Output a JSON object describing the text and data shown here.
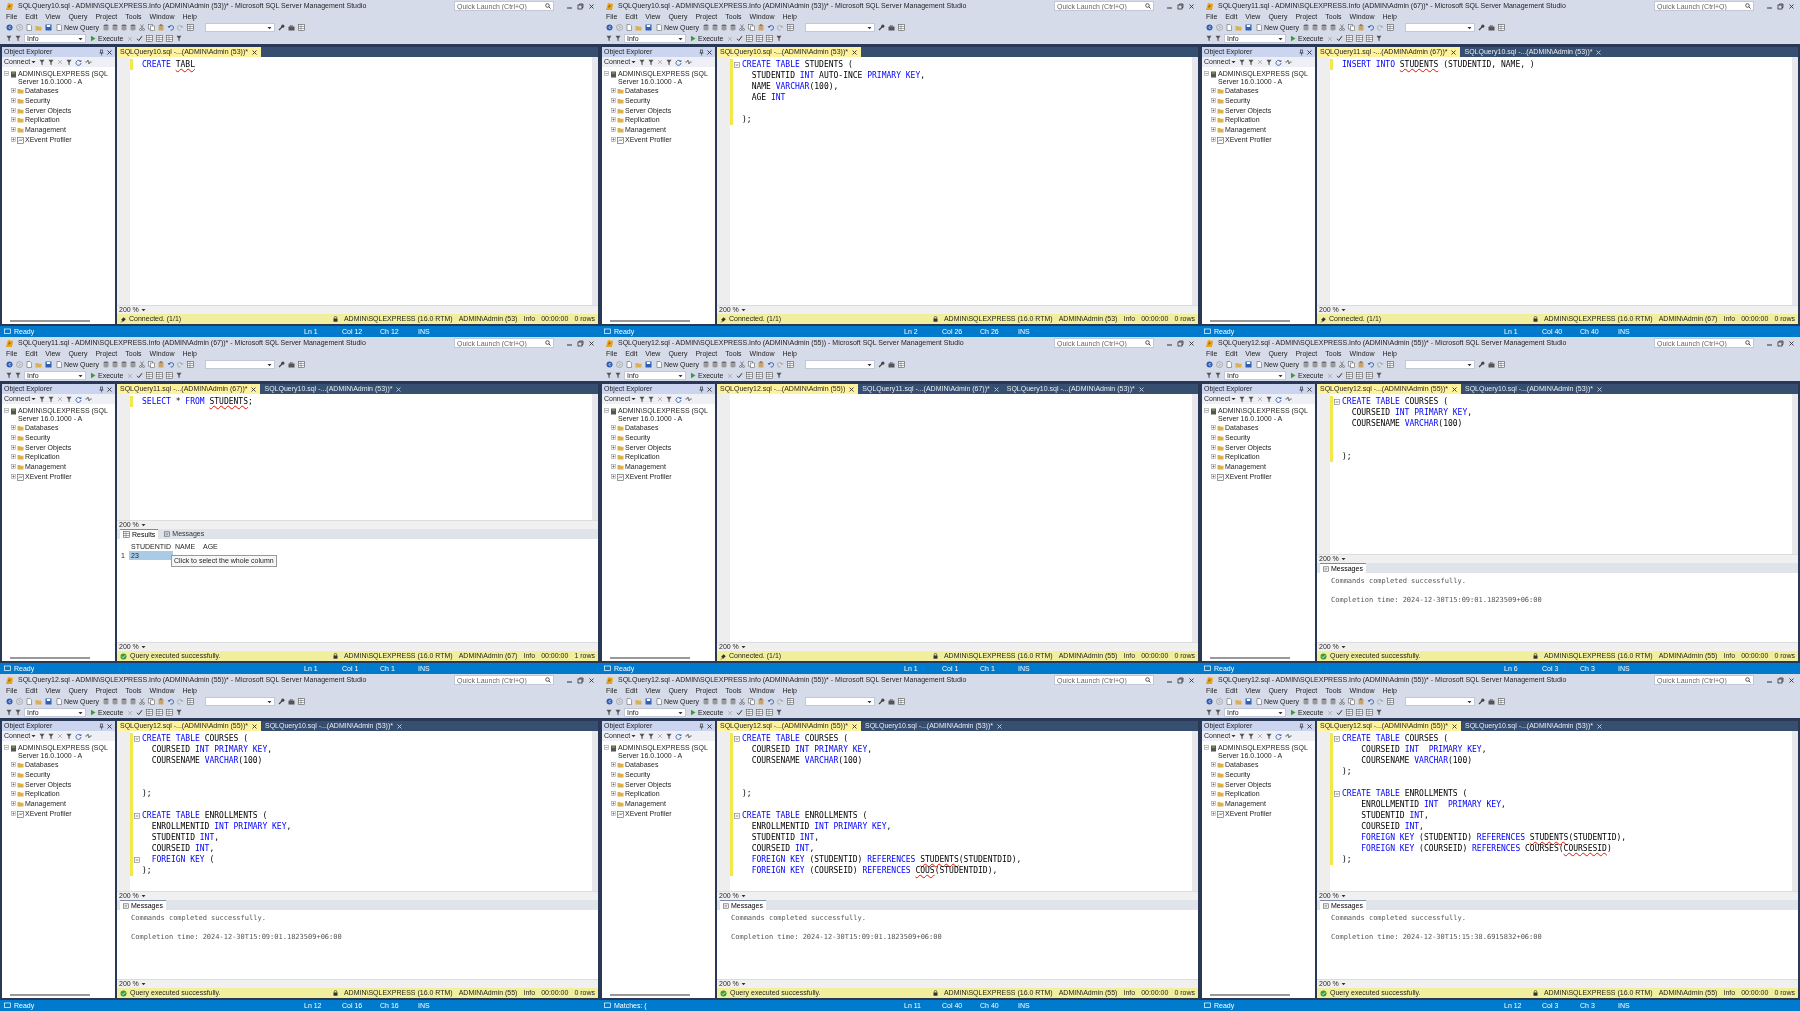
{
  "panels": [
    {
      "title": "SQLQuery10.sql - ADMIN\\SQLEXPRESS.Info (ADMIN\\Admin (53))* - Microsoft SQL Server Management Studio",
      "quick_launch": {
        "placeholder": "Quick Launch (Ctrl+Q)"
      },
      "menu": [
        "File",
        "Edit",
        "View",
        "Query",
        "Project",
        "Tools",
        "Window",
        "Help"
      ],
      "toolbar": {
        "new_query": "New Query",
        "database": "Info",
        "execute": "Execute"
      },
      "object_explorer": {
        "title": "Object Explorer",
        "connect": "Connect",
        "nodes": [
          {
            "label": "ADMIN\\SQLEXPRESS (SQL Server 16.0.1000 - A",
            "kind": "server",
            "expanded": true,
            "children": [
              {
                "label": "Databases",
                "kind": "folder",
                "expanded": false
              },
              {
                "label": "Security",
                "kind": "folder",
                "expanded": false
              },
              {
                "label": "Server Objects",
                "kind": "folder",
                "expanded": false
              },
              {
                "label": "Replication",
                "kind": "folder",
                "expanded": false
              },
              {
                "label": "Management",
                "kind": "folder",
                "expanded": false
              },
              {
                "label": "XEvent Profiler",
                "kind": "profiler",
                "expanded": false
              }
            ]
          }
        ]
      },
      "tabs": [
        {
          "label": "SQLQuery10.sql -...(ADMIN\\Admin (53))*",
          "selected": true
        }
      ],
      "code": [
        {
          "fold": false,
          "parts": [
            {
              "text": "CREATE ",
              "kind": "keyword"
            },
            {
              "text": "TABL",
              "kind": "error"
            }
          ]
        }
      ],
      "editor_zoom": "200 %",
      "query_status": {
        "kind": "connected",
        "text": "Connected. (1/1)"
      },
      "server": "ADMIN\\SQLEXPRESS (16.0 RTM)",
      "session": "ADMIN\\Admin (53)",
      "database": "Info",
      "elapsed": "00:00:00",
      "rows": "0 rows",
      "status_bar": {
        "message": "Ready",
        "line": "Ln 1",
        "column": "Col 12",
        "char": "Ch 12",
        "mode": "INS"
      }
    },
    {
      "title": "SQLQuery10.sql - ADMIN\\SQLEXPRESS.Info (ADMIN\\Admin (53))* - Microsoft SQL Server Management Studio",
      "quick_launch": {
        "placeholder": "Quick Launch (Ctrl+Q)"
      },
      "menu": [
        "File",
        "Edit",
        "View",
        "Query",
        "Project",
        "Tools",
        "Window",
        "Help"
      ],
      "toolbar": {
        "new_query": "New Query",
        "database": "Info",
        "execute": "Execute"
      },
      "object_explorer": {
        "title": "Object Explorer",
        "connect": "Connect",
        "nodes": [
          {
            "label": "ADMIN\\SQLEXPRESS (SQL Server 16.0.1000 - A",
            "kind": "server",
            "expanded": true,
            "children": [
              {
                "label": "Databases",
                "kind": "folder",
                "expanded": false
              },
              {
                "label": "Security",
                "kind": "folder",
                "expanded": false
              },
              {
                "label": "Server Objects",
                "kind": "folder",
                "expanded": false
              },
              {
                "label": "Replication",
                "kind": "folder",
                "expanded": false
              },
              {
                "label": "Management",
                "kind": "folder",
                "expanded": false
              },
              {
                "label": "XEvent Profiler",
                "kind": "profiler",
                "expanded": false
              }
            ]
          }
        ]
      },
      "tabs": [
        {
          "label": "SQLQuery10.sql -...(ADMIN\\Admin (53))*",
          "selected": true
        }
      ],
      "code": [
        {
          "fold": true,
          "parts": [
            {
              "text": "CREATE TABLE ",
              "kind": "keyword"
            },
            {
              "text": "STUDENTS (",
              "kind": "plain"
            }
          ]
        },
        {
          "fold": false,
          "parts": [
            {
              "text": "  STUDENTID ",
              "kind": "plain"
            },
            {
              "text": "INT ",
              "kind": "keyword"
            },
            {
              "text": "AUTO-INCE ",
              "kind": "plain"
            },
            {
              "text": "PRIMARY KEY",
              "kind": "keyword"
            },
            {
              "text": ",",
              "kind": "plain"
            }
          ]
        },
        {
          "fold": false,
          "parts": [
            {
              "text": "  NAME ",
              "kind": "plain"
            },
            {
              "text": "VARCHAR",
              "kind": "keyword"
            },
            {
              "text": "(100),",
              "kind": "plain"
            }
          ]
        },
        {
          "fold": false,
          "parts": [
            {
              "text": "  AGE ",
              "kind": "plain"
            },
            {
              "text": "INT",
              "kind": "keyword"
            }
          ]
        },
        {
          "fold": false
        },
        {
          "fold": false,
          "parts": [
            {
              "text": ");",
              "kind": "plain"
            }
          ]
        }
      ],
      "editor_zoom": "200 %",
      "query_status": {
        "kind": "connected",
        "text": "Connected. (1/1)"
      },
      "server": "ADMIN\\SQLEXPRESS (16.0 RTM)",
      "session": "ADMIN\\Admin (53)",
      "database": "Info",
      "elapsed": "00:00:00",
      "rows": "0 rows",
      "status_bar": {
        "message": "Ready",
        "line": "Ln 2",
        "column": "Col 26",
        "char": "Ch 26",
        "mode": "INS"
      }
    },
    {
      "title": "SQLQuery11.sql - ADMIN\\SQLEXPRESS.Info (ADMIN\\Admin (67))* - Microsoft SQL Server Management Studio",
      "quick_launch": {
        "placeholder": "Quick Launch (Ctrl+Q)"
      },
      "menu": [
        "File",
        "Edit",
        "View",
        "Query",
        "Project",
        "Tools",
        "Window",
        "Help"
      ],
      "toolbar": {
        "new_query": "New Query",
        "database": "Info",
        "execute": "Execute"
      },
      "object_explorer": {
        "title": "Object Explorer",
        "connect": "Connect",
        "nodes": [
          {
            "label": "ADMIN\\SQLEXPRESS (SQL Server 16.0.1000 - A",
            "kind": "server",
            "expanded": true,
            "children": [
              {
                "label": "Databases",
                "kind": "folder",
                "expanded": false
              },
              {
                "label": "Security",
                "kind": "folder",
                "expanded": false
              },
              {
                "label": "Server Objects",
                "kind": "folder",
                "expanded": false
              },
              {
                "label": "Replication",
                "kind": "folder",
                "expanded": false
              },
              {
                "label": "Management",
                "kind": "folder",
                "expanded": false
              },
              {
                "label": "XEvent Profiler",
                "kind": "profiler",
                "expanded": false
              }
            ]
          }
        ]
      },
      "tabs": [
        {
          "label": "SQLQuery11.sql -...(ADMIN\\Admin (67))*",
          "selected": true
        },
        {
          "label": "SQLQuery10.sql -...(ADMIN\\Admin (53))*",
          "selected": false
        }
      ],
      "code": [
        {
          "fold": false,
          "parts": [
            {
              "text": "INSERT INTO ",
              "kind": "keyword"
            },
            {
              "text": "STUDENTS",
              "kind": "error"
            },
            {
              "text": " (STUDENTID, NAME, )",
              "kind": "plain"
            }
          ]
        }
      ],
      "editor_zoom": "200 %",
      "query_status": {
        "kind": "connected",
        "text": "Connected. (1/1)"
      },
      "server": "ADMIN\\SQLEXPRESS (16.0 RTM)",
      "session": "ADMIN\\Admin (67)",
      "database": "Info",
      "elapsed": "00:00:00",
      "rows": "0 rows",
      "status_bar": {
        "message": "Ready",
        "line": "Ln 1",
        "column": "Col 40",
        "char": "Ch 40",
        "mode": "INS"
      }
    },
    {
      "title": "SQLQuery11.sql - ADMIN\\SQLEXPRESS.Info (ADMIN\\Admin (67))* - Microsoft SQL Server Management Studio",
      "quick_launch": {
        "placeholder": "Quick Launch (Ctrl+Q)"
      },
      "menu": [
        "File",
        "Edit",
        "View",
        "Query",
        "Project",
        "Tools",
        "Window",
        "Help"
      ],
      "toolbar": {
        "new_query": "New Query",
        "database": "Info",
        "execute": "Execute"
      },
      "object_explorer": {
        "title": "Object Explorer",
        "connect": "Connect",
        "nodes": [
          {
            "label": "ADMIN\\SQLEXPRESS (SQL Server 16.0.1000 - A",
            "kind": "server",
            "expanded": true,
            "children": [
              {
                "label": "Databases",
                "kind": "folder",
                "expanded": false
              },
              {
                "label": "Security",
                "kind": "folder",
                "expanded": false
              },
              {
                "label": "Server Objects",
                "kind": "folder",
                "expanded": false
              },
              {
                "label": "Replication",
                "kind": "folder",
                "expanded": false
              },
              {
                "label": "Management",
                "kind": "folder",
                "expanded": false
              },
              {
                "label": "XEvent Profiler",
                "kind": "profiler",
                "expanded": false
              }
            ]
          }
        ]
      },
      "tabs": [
        {
          "label": "SQLQuery11.sql -...(ADMIN\\Admin (67))*",
          "selected": true
        },
        {
          "label": "SQLQuery10.sql -...(ADMIN\\Admin (53))*",
          "selected": false
        }
      ],
      "code": [
        {
          "fold": false,
          "parts": [
            {
              "text": "SELECT ",
              "kind": "keyword"
            },
            {
              "text": "* ",
              "kind": "plain"
            },
            {
              "text": "FROM ",
              "kind": "keyword"
            },
            {
              "text": "STUDENTS",
              "kind": "error"
            },
            {
              "text": ";",
              "kind": "plain"
            }
          ]
        }
      ],
      "editor_zoom": "200 %",
      "results": {
        "kind": "grid",
        "zoom": "200 %",
        "tabs": [
          {
            "label": "Results",
            "selected": true
          },
          {
            "label": "Messages",
            "selected": false
          }
        ],
        "columns": [
          "STUDENTID",
          "NAME",
          "AGE"
        ],
        "rows": [
          {
            "number": "1",
            "cells": [
              {
                "text": "23",
                "selected": true
              }
            ]
          }
        ],
        "tooltip": "Click to select the whole column"
      },
      "query_status": {
        "kind": "success",
        "text": "Query executed successfully."
      },
      "server": "ADMIN\\SQLEXPRESS (16.0 RTM)",
      "session": "ADMIN\\Admin (67)",
      "database": "Info",
      "elapsed": "00:00:00",
      "rows": "1 rows",
      "status_bar": {
        "message": "Ready",
        "line": "Ln 1",
        "column": "Col 1",
        "char": "Ch 1",
        "mode": "INS"
      }
    },
    {
      "title": "SQLQuery12.sql - ADMIN\\SQLEXPRESS.Info (ADMIN\\Admin (55)) - Microsoft SQL Server Management Studio",
      "quick_launch": {
        "placeholder": "Quick Launch (Ctrl+Q)"
      },
      "menu": [
        "File",
        "Edit",
        "View",
        "Query",
        "Project",
        "Tools",
        "Window",
        "Help"
      ],
      "toolbar": {
        "new_query": "New Query",
        "database": "Info",
        "execute": "Execute"
      },
      "object_explorer": {
        "title": "Object Explorer",
        "connect": "Connect",
        "nodes": [
          {
            "label": "ADMIN\\SQLEXPRESS (SQL Server 16.0.1000 - A",
            "kind": "server",
            "expanded": true,
            "children": [
              {
                "label": "Databases",
                "kind": "folder",
                "expanded": false
              },
              {
                "label": "Security",
                "kind": "folder",
                "expanded": false
              },
              {
                "label": "Server Objects",
                "kind": "folder",
                "expanded": false
              },
              {
                "label": "Replication",
                "kind": "folder",
                "expanded": false
              },
              {
                "label": "Management",
                "kind": "folder",
                "expanded": false
              },
              {
                "label": "XEvent Profiler",
                "kind": "profiler",
                "expanded": false
              }
            ]
          }
        ]
      },
      "tabs": [
        {
          "label": "SQLQuery12.sql -...(ADMIN\\Admin (55))",
          "selected": true
        },
        {
          "label": "SQLQuery11.sql -...(ADMIN\\Admin (67))*",
          "selected": false
        },
        {
          "label": "SQLQuery10.sql -...(ADMIN\\Admin (53))*",
          "selected": false
        }
      ],
      "editor_zoom": "200 %",
      "query_status": {
        "kind": "connected",
        "text": "Connected. (1/1)"
      },
      "server": "ADMIN\\SQLEXPRESS (16.0 RTM)",
      "session": "ADMIN\\Admin (55)",
      "database": "Info",
      "elapsed": "00:00:00",
      "rows": "0 rows",
      "status_bar": {
        "message": "Ready",
        "line": "Ln 1",
        "column": "Col 1",
        "char": "Ch 1",
        "mode": "INS"
      }
    },
    {
      "title": "SQLQuery12.sql - ADMIN\\SQLEXPRESS.Info (ADMIN\\Admin (55))* - Microsoft SQL Server Management Studio",
      "quick_launch": {
        "placeholder": "Quick Launch (Ctrl+Q)"
      },
      "menu": [
        "File",
        "Edit",
        "View",
        "Query",
        "Project",
        "Tools",
        "Window",
        "Help"
      ],
      "toolbar": {
        "new_query": "New Query",
        "database": "Info",
        "execute": "Execute"
      },
      "object_explorer": {
        "title": "Object Explorer",
        "connect": "Connect",
        "nodes": [
          {
            "label": "ADMIN\\SQLEXPRESS (SQL Server 16.0.1000 - A",
            "kind": "server",
            "expanded": true,
            "children": [
              {
                "label": "Databases",
                "kind": "folder",
                "expanded": false
              },
              {
                "label": "Security",
                "kind": "folder",
                "expanded": false
              },
              {
                "label": "Server Objects",
                "kind": "folder",
                "expanded": false
              },
              {
                "label": "Replication",
                "kind": "folder",
                "expanded": false
              },
              {
                "label": "Management",
                "kind": "folder",
                "expanded": false
              },
              {
                "label": "XEvent Profiler",
                "kind": "profiler",
                "expanded": false
              }
            ]
          }
        ]
      },
      "tabs": [
        {
          "label": "SQLQuery12.sql -...(ADMIN\\Admin (55))*",
          "selected": true
        },
        {
          "label": "SQLQuery10.sql -...(ADMIN\\Admin (53))*",
          "selected": false
        }
      ],
      "code": [
        {
          "fold": true,
          "parts": [
            {
              "text": "CREATE TABLE ",
              "kind": "keyword"
            },
            {
              "text": "COURSES (",
              "kind": "plain"
            }
          ]
        },
        {
          "fold": false,
          "parts": [
            {
              "text": "  COURSEID ",
              "kind": "plain"
            },
            {
              "text": "INT PRIMARY KEY",
              "kind": "keyword"
            },
            {
              "text": ",",
              "kind": "plain"
            }
          ]
        },
        {
          "fold": false,
          "parts": [
            {
              "text": "  COURSENAME ",
              "kind": "plain"
            },
            {
              "text": "VARCHAR",
              "kind": "keyword"
            },
            {
              "text": "(100)",
              "kind": "plain"
            }
          ]
        },
        {
          "fold": false
        },
        {
          "fold": false
        },
        {
          "fold": false,
          "parts": [
            {
              "text": ");",
              "kind": "plain"
            }
          ]
        }
      ],
      "editor_zoom": "200 %",
      "results": {
        "kind": "messages",
        "zoom": "200 %",
        "tab": "Messages",
        "lines": [
          "Commands completed successfully.",
          "Completion time: 2024-12-30T15:09:01.1823509+06:00"
        ]
      },
      "query_status": {
        "kind": "success",
        "text": "Query executed successfully."
      },
      "server": "ADMIN\\SQLEXPRESS (16.0 RTM)",
      "session": "ADMIN\\Admin (55)",
      "database": "Info",
      "elapsed": "00:00:00",
      "rows": "0 rows",
      "status_bar": {
        "message": "Ready",
        "line": "Ln 6",
        "column": "Col 3",
        "char": "Ch 3",
        "mode": "INS"
      }
    },
    {
      "title": "SQLQuery12.sql - ADMIN\\SQLEXPRESS.Info (ADMIN\\Admin (55))* - Microsoft SQL Server Management Studio",
      "quick_launch": {
        "placeholder": "Quick Launch (Ctrl+Q)"
      },
      "menu": [
        "File",
        "Edit",
        "View",
        "Query",
        "Project",
        "Tools",
        "Window",
        "Help"
      ],
      "toolbar": {
        "new_query": "New Query",
        "database": "Info",
        "execute": "Execute"
      },
      "object_explorer": {
        "title": "Object Explorer",
        "connect": "Connect",
        "nodes": [
          {
            "label": "ADMIN\\SQLEXPRESS (SQL Server 16.0.1000 - A",
            "kind": "server",
            "expanded": true,
            "children": [
              {
                "label": "Databases",
                "kind": "folder",
                "expanded": false
              },
              {
                "label": "Security",
                "kind": "folder",
                "expanded": false
              },
              {
                "label": "Server Objects",
                "kind": "folder",
                "expanded": false
              },
              {
                "label": "Replication",
                "kind": "folder",
                "expanded": false
              },
              {
                "label": "Management",
                "kind": "folder",
                "expanded": false
              },
              {
                "label": "XEvent Profiler",
                "kind": "profiler",
                "expanded": false
              }
            ]
          }
        ]
      },
      "tabs": [
        {
          "label": "SQLQuery12.sql -...(ADMIN\\Admin (55))*",
          "selected": true
        },
        {
          "label": "SQLQuery10.sql -...(ADMIN\\Admin (53))*",
          "selected": false
        }
      ],
      "code": [
        {
          "fold": true,
          "parts": [
            {
              "text": "CREATE TABLE ",
              "kind": "keyword"
            },
            {
              "text": "COURSES (",
              "kind": "plain"
            }
          ]
        },
        {
          "fold": false,
          "parts": [
            {
              "text": "  COURSEID ",
              "kind": "plain"
            },
            {
              "text": "INT PRIMARY KEY",
              "kind": "keyword"
            },
            {
              "text": ",",
              "kind": "plain"
            }
          ]
        },
        {
          "fold": false,
          "parts": [
            {
              "text": "  COURSENAME ",
              "kind": "plain"
            },
            {
              "text": "VARCHAR",
              "kind": "keyword"
            },
            {
              "text": "(100)",
              "kind": "plain"
            }
          ]
        },
        {
          "fold": false
        },
        {
          "fold": false
        },
        {
          "fold": false,
          "parts": [
            {
              "text": ");",
              "kind": "plain"
            }
          ]
        },
        {
          "fold": false
        },
        {
          "fold": true,
          "parts": [
            {
              "text": "CREATE TABLE ",
              "kind": "keyword"
            },
            {
              "text": "ENROLLMENTS (",
              "kind": "plain"
            }
          ]
        },
        {
          "fold": false,
          "parts": [
            {
              "text": "  ENROLLMENTID ",
              "kind": "plain"
            },
            {
              "text": "INT PRIMARY KEY",
              "kind": "keyword"
            },
            {
              "text": ",",
              "kind": "plain"
            }
          ]
        },
        {
          "fold": false,
          "parts": [
            {
              "text": "  STUDENTID ",
              "kind": "plain"
            },
            {
              "text": "INT",
              "kind": "keyword"
            },
            {
              "text": ",",
              "kind": "plain"
            }
          ]
        },
        {
          "fold": false,
          "parts": [
            {
              "text": "  COURSEID ",
              "kind": "plain"
            },
            {
              "text": "INT",
              "kind": "keyword"
            },
            {
              "text": ",",
              "kind": "plain"
            }
          ]
        },
        {
          "fold": true,
          "parts": [
            {
              "text": "  FOREIGN KEY ",
              "kind": "keyword"
            },
            {
              "text": "(",
              "kind": "plain"
            }
          ]
        },
        {
          "fold": false,
          "parts": [
            {
              "text": ");",
              "kind": "plain"
            }
          ]
        }
      ],
      "editor_zoom": "200 %",
      "results": {
        "kind": "messages",
        "zoom": "200 %",
        "tab": "Messages",
        "lines": [
          "Commands completed successfully.",
          "Completion time: 2024-12-30T15:09:01.1823509+06:00"
        ]
      },
      "query_status": {
        "kind": "success",
        "text": "Query executed successfully."
      },
      "server": "ADMIN\\SQLEXPRESS (16.0 RTM)",
      "session": "ADMIN\\Admin (55)",
      "database": "Info",
      "elapsed": "00:00:00",
      "rows": "0 rows",
      "status_bar": {
        "message": "Ready",
        "line": "Ln 12",
        "column": "Col 16",
        "char": "Ch 16",
        "mode": "INS"
      }
    },
    {
      "title": "SQLQuery12.sql - ADMIN\\SQLEXPRESS.Info (ADMIN\\Admin (55))* - Microsoft SQL Server Management Studio",
      "quick_launch": {
        "placeholder": "Quick Launch (Ctrl+Q)"
      },
      "menu": [
        "File",
        "Edit",
        "View",
        "Query",
        "Project",
        "Tools",
        "Window",
        "Help"
      ],
      "toolbar": {
        "new_query": "New Query",
        "database": "Info",
        "execute": "Execute"
      },
      "object_explorer": {
        "title": "Object Explorer",
        "connect": "Connect",
        "nodes": [
          {
            "label": "ADMIN\\SQLEXPRESS (SQL Server 16.0.1000 - A",
            "kind": "server",
            "expanded": true,
            "children": [
              {
                "label": "Databases",
                "kind": "folder",
                "expanded": false
              },
              {
                "label": "Security",
                "kind": "folder",
                "expanded": false
              },
              {
                "label": "Server Objects",
                "kind": "folder",
                "expanded": false
              },
              {
                "label": "Replication",
                "kind": "folder",
                "expanded": false
              },
              {
                "label": "Management",
                "kind": "folder",
                "expanded": false
              },
              {
                "label": "XEvent Profiler",
                "kind": "profiler",
                "expanded": false
              }
            ]
          }
        ]
      },
      "tabs": [
        {
          "label": "SQLQuery12.sql -...(ADMIN\\Admin (55))*",
          "selected": true
        },
        {
          "label": "SQLQuery10.sql -...(ADMIN\\Admin (53))*",
          "selected": false
        }
      ],
      "code": [
        {
          "fold": true,
          "parts": [
            {
              "text": "CREATE TABLE ",
              "kind": "keyword"
            },
            {
              "text": "COURSES (",
              "kind": "plain"
            }
          ]
        },
        {
          "fold": false,
          "parts": [
            {
              "text": "  COURSEID ",
              "kind": "plain"
            },
            {
              "text": "INT PRIMARY KEY",
              "kind": "keyword"
            },
            {
              "text": ",",
              "kind": "plain"
            }
          ]
        },
        {
          "fold": false,
          "parts": [
            {
              "text": "  COURSENAME ",
              "kind": "plain"
            },
            {
              "text": "VARCHAR",
              "kind": "keyword"
            },
            {
              "text": "(100)",
              "kind": "plain"
            }
          ]
        },
        {
          "fold": false
        },
        {
          "fold": false
        },
        {
          "fold": false,
          "parts": [
            {
              "text": ");",
              "kind": "plain"
            }
          ]
        },
        {
          "fold": false
        },
        {
          "fold": true,
          "parts": [
            {
              "text": "CREATE TABLE ",
              "kind": "keyword"
            },
            {
              "text": "ENROLLMENTS (",
              "kind": "plain"
            }
          ]
        },
        {
          "fold": false,
          "parts": [
            {
              "text": "  ENROLLMENTID ",
              "kind": "plain"
            },
            {
              "text": "INT PRIMARY KEY",
              "kind": "keyword"
            },
            {
              "text": ",",
              "kind": "plain"
            }
          ]
        },
        {
          "fold": false,
          "parts": [
            {
              "text": "  STUDENTID ",
              "kind": "plain"
            },
            {
              "text": "INT",
              "kind": "keyword"
            },
            {
              "text": ",",
              "kind": "plain"
            }
          ]
        },
        {
          "fold": false,
          "parts": [
            {
              "text": "  COURSEID ",
              "kind": "plain"
            },
            {
              "text": "INT",
              "kind": "keyword"
            },
            {
              "text": ",",
              "kind": "plain"
            }
          ]
        },
        {
          "fold": false,
          "parts": [
            {
              "text": "  FOREIGN KEY ",
              "kind": "keyword"
            },
            {
              "text": "(STUDENTID) ",
              "kind": "plain"
            },
            {
              "text": "REFERENCES ",
              "kind": "keyword"
            },
            {
              "text": "STUDENTS",
              "kind": "error"
            },
            {
              "text": "(STUDENTDID),",
              "kind": "plain"
            }
          ]
        },
        {
          "fold": false,
          "parts": [
            {
              "text": "  FOREIGN KEY ",
              "kind": "keyword"
            },
            {
              "text": "(COURSEID) ",
              "kind": "plain"
            },
            {
              "text": "REFERENCES ",
              "kind": "keyword"
            },
            {
              "text": "COUS",
              "kind": "error"
            },
            {
              "text": "(STUDENTDID),",
              "kind": "plain"
            }
          ]
        }
      ],
      "editor_zoom": "200 %",
      "results": {
        "kind": "messages",
        "zoom": "200 %",
        "tab": "Messages",
        "lines": [
          "Commands completed successfully.",
          "Completion time: 2024-12-30T15:09:01.1823509+06:00"
        ]
      },
      "query_status": {
        "kind": "success",
        "text": "Query executed successfully."
      },
      "server": "ADMIN\\SQLEXPRESS (16.0 RTM)",
      "session": "ADMIN\\Admin (55)",
      "database": "Info",
      "elapsed": "00:00:00",
      "rows": "0 rows",
      "status_bar": {
        "message": "Matches: (",
        "line": "Ln 11",
        "column": "Col 40",
        "char": "Ch 40",
        "mode": "INS"
      }
    },
    {
      "title": "SQLQuery12.sql - ADMIN\\SQLEXPRESS.Info (ADMIN\\Admin (55))* - Microsoft SQL Server Management Studio",
      "quick_launch": {
        "placeholder": "Quick Launch (Ctrl+Q)"
      },
      "menu": [
        "File",
        "Edit",
        "View",
        "Query",
        "Project",
        "Tools",
        "Window",
        "Help"
      ],
      "toolbar": {
        "new_query": "New Query",
        "database": "Info",
        "execute": "Execute"
      },
      "object_explorer": {
        "title": "Object Explorer",
        "connect": "Connect",
        "nodes": [
          {
            "label": "ADMIN\\SQLEXPRESS (SQL Server 16.0.1000 - A",
            "kind": "server",
            "expanded": true,
            "children": [
              {
                "label": "Databases",
                "kind": "folder",
                "expanded": false
              },
              {
                "label": "Security",
                "kind": "folder",
                "expanded": false
              },
              {
                "label": "Server Objects",
                "kind": "folder",
                "expanded": false
              },
              {
                "label": "Replication",
                "kind": "folder",
                "expanded": false
              },
              {
                "label": "Management",
                "kind": "folder",
                "expanded": false
              },
              {
                "label": "XEvent Profiler",
                "kind": "profiler",
                "expanded": false
              }
            ]
          }
        ]
      },
      "tabs": [
        {
          "label": "SQLQuery12.sql -...(ADMIN\\Admin (55))*",
          "selected": true
        },
        {
          "label": "SQLQuery10.sql -...(ADMIN\\Admin (53))*",
          "selected": false
        }
      ],
      "code": [
        {
          "fold": true,
          "parts": [
            {
              "text": "CREATE TABLE ",
              "kind": "keyword"
            },
            {
              "text": "COURSES (",
              "kind": "plain"
            }
          ]
        },
        {
          "fold": false,
          "parts": [
            {
              "text": "    COURSEID ",
              "kind": "plain"
            },
            {
              "text": "INT  PRIMARY KEY",
              "kind": "keyword"
            },
            {
              "text": ",",
              "kind": "plain"
            }
          ]
        },
        {
          "fold": false,
          "parts": [
            {
              "text": "    COURSENAME ",
              "kind": "plain"
            },
            {
              "text": "VARCHAR",
              "kind": "keyword"
            },
            {
              "text": "(100)",
              "kind": "plain"
            }
          ]
        },
        {
          "fold": false,
          "parts": [
            {
              "text": ");",
              "kind": "plain"
            }
          ]
        },
        {
          "fold": false
        },
        {
          "fold": true,
          "parts": [
            {
              "text": "CREATE TABLE ",
              "kind": "keyword"
            },
            {
              "text": "ENROLLMENTS (",
              "kind": "plain"
            }
          ]
        },
        {
          "fold": false,
          "parts": [
            {
              "text": "    ENROLLMENTID ",
              "kind": "plain"
            },
            {
              "text": "INT  PRIMARY KEY",
              "kind": "keyword"
            },
            {
              "text": ",",
              "kind": "plain"
            }
          ]
        },
        {
          "fold": false,
          "parts": [
            {
              "text": "    STUDENTID ",
              "kind": "plain"
            },
            {
              "text": "INT",
              "kind": "keyword"
            },
            {
              "text": ",",
              "kind": "plain"
            }
          ]
        },
        {
          "fold": false,
          "parts": [
            {
              "text": "    COURSEID ",
              "kind": "plain"
            },
            {
              "text": "INT",
              "kind": "keyword"
            },
            {
              "text": ",",
              "kind": "plain"
            }
          ]
        },
        {
          "fold": false,
          "parts": [
            {
              "text": "    FOREIGN KEY ",
              "kind": "keyword"
            },
            {
              "text": "(STUDENTID) ",
              "kind": "plain"
            },
            {
              "text": "REFERENCES ",
              "kind": "keyword"
            },
            {
              "text": "STUDENTS",
              "kind": "error"
            },
            {
              "text": "(STUDENTID),",
              "kind": "plain"
            }
          ]
        },
        {
          "fold": false,
          "parts": [
            {
              "text": "    FOREIGN KEY ",
              "kind": "keyword"
            },
            {
              "text": "(COURSEID) ",
              "kind": "plain"
            },
            {
              "text": "REFERENCES ",
              "kind": "keyword"
            },
            {
              "text": "COURSES(",
              "kind": "plain"
            },
            {
              "text": "COURSESID",
              "kind": "error"
            },
            {
              "text": ")",
              "kind": "plain"
            }
          ]
        },
        {
          "fold": false,
          "parts": [
            {
              "text": ");",
              "kind": "plain"
            }
          ]
        }
      ],
      "editor_zoom": "200 %",
      "results": {
        "kind": "messages",
        "zoom": "200 %",
        "tab": "Messages",
        "lines": [
          "Commands completed successfully.",
          "Completion time: 2024-12-30T15:15:38.6915832+06:00"
        ]
      },
      "query_status": {
        "kind": "success",
        "text": "Query executed successfully."
      },
      "server": "ADMIN\\SQLEXPRESS (16.0 RTM)",
      "session": "ADMIN\\Admin (55)",
      "database": "Info",
      "elapsed": "00:00:00",
      "rows": "0 rows",
      "status_bar": {
        "message": "Ready",
        "line": "Ln 12",
        "column": "Col 3",
        "char": "Ch 3",
        "mode": "INS"
      }
    }
  ]
}
